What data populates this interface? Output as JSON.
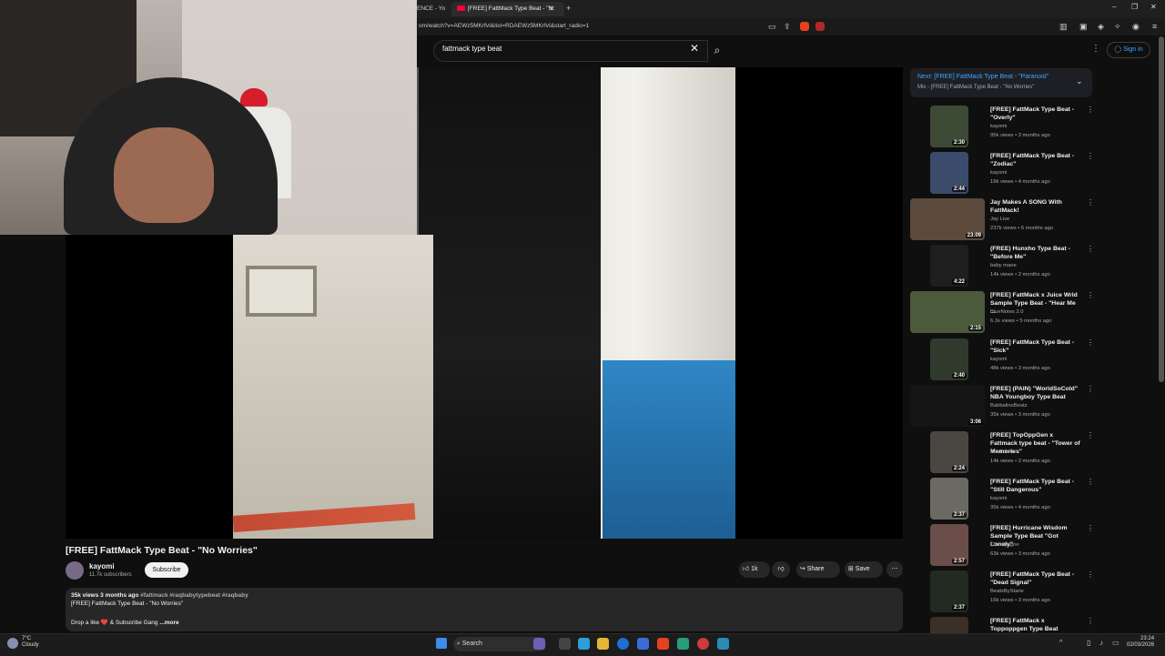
{
  "browser": {
    "tabs": [
      {
        "label": "ENCE - Yo"
      },
      {
        "label": "[FREE] FattMack Type Beat - \"N"
      }
    ],
    "url": "om/watch?v=AEWz5MKrfvI&list=RDAEWz5MKrfvI&start_radio=1"
  },
  "header": {
    "search_value": "fattmack type beat",
    "sign_in_label": "Sign in"
  },
  "video": {
    "title": "[FREE] FattMack Type Beat - \"No Worries\"",
    "channel": "kayomi",
    "subscribers": "11.7k subscribers",
    "subscribe_label": "Subscribe",
    "likes": "1k",
    "share_label": "Share",
    "save_label": "Save",
    "views_date": "35k views  3 months ago",
    "hashtags": "#fattmack #raqbabytypebeat #raqbaby",
    "desc_line": "[FREE] FattMack Type Beat - \"No Worries\"",
    "desc_line2": "Drop a like ❤️ & Subscribe Gang",
    "more_label": "...more"
  },
  "up_next": {
    "next_title": "Next: [FREE] FattMack Type Beat - \"Paranoid\"",
    "mix_label": "Mix - [FREE] FattMack Type Beat - \"No Worries\""
  },
  "recommendations": [
    {
      "title": "[FREE] FattMack Type Beat - \"Overly\"",
      "channel": "kayomi",
      "meta": "95k views • 3 months ago",
      "duration": "2:30",
      "color": "#3d4a36"
    },
    {
      "title": "[FREE] FattMack Type Beat - \"Zodiac\"",
      "channel": "kayomi",
      "meta": "19k views • 4 months ago",
      "duration": "2:44",
      "color": "#3a4b6b"
    },
    {
      "title": "Jay Makes A SONG With FattMack!",
      "channel": "Jay Live",
      "meta": "237k views • 6 months ago",
      "duration": "23:09",
      "color": "#5b4a3c"
    },
    {
      "title": "(FREE) Hunxho Type Beat - \"Before Me\"",
      "channel": "baby mane",
      "meta": "14k views • 2 months ago",
      "duration": "4:22",
      "color": "#1e1e1e"
    },
    {
      "title": "[FREE] FattMack x Juice Wrld Sample Type Beat - \"Hear Me ...",
      "channel": "BlueNotes 2.0",
      "meta": "6.1k views • 5 months ago",
      "duration": "2:15",
      "color": "#4b5a3a"
    },
    {
      "title": "[FREE] FattMack Type Beat - \"Sick\"",
      "channel": "kayomi",
      "meta": "48k views • 3 months ago",
      "duration": "2:40",
      "color": "#2f3a2c"
    },
    {
      "title": "[FREE] (PAIN) \"WorldSoCold\" NBA Youngboy Type Beat",
      "channel": "BabbalinoBeatz",
      "meta": "35k views • 3 months ago",
      "duration": "3:06",
      "color": "#151515"
    },
    {
      "title": "[FREE] TopOppGen x Fattmack type beat - \"Tower of Memories\"",
      "channel": "Prod. Jett",
      "meta": "14k views • 2 months ago",
      "duration": "2:24",
      "color": "#4a4642"
    },
    {
      "title": "[FREE] FattMack Type Beat - \"Still Dangerous\"",
      "channel": "kayomi",
      "meta": "35k views • 4 months ago",
      "duration": "2:37",
      "color": "#6a6a62"
    },
    {
      "title": "[FREE] Hurricane Wisdom Sample Type Beat \"Got Lonely\"",
      "channel": "Champagne",
      "meta": "63k views • 3 months ago",
      "duration": "2:57",
      "color": "#6b4d4a"
    },
    {
      "title": "[FREE] FattMack Type Beat - \"Dead Signal\"",
      "channel": "BeatsByStarie",
      "meta": "16k views • 3 months ago",
      "duration": "2:37",
      "color": "#222a22"
    },
    {
      "title": "[FREE] FattMack x Toppoppgen Type Beat \"Romantic Violence\"",
      "channel": "",
      "meta": "",
      "duration": "",
      "color": "#3a3028"
    }
  ],
  "taskbar": {
    "search_label": "Search",
    "weather_temp": "7°C",
    "weather_desc": "Cloudy",
    "time": "23:24",
    "date": "02/03/2026"
  }
}
